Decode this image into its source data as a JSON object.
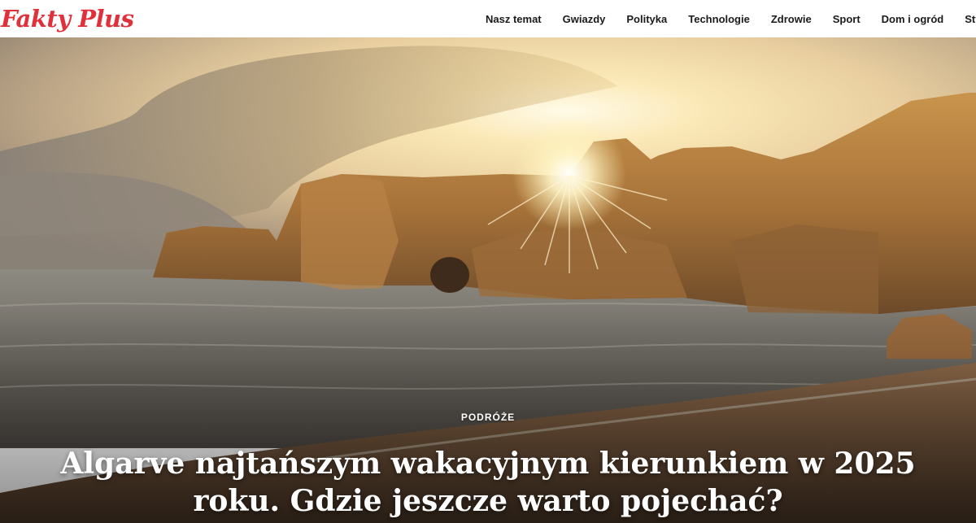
{
  "header": {
    "logo": "Fakty Plus",
    "nav": [
      "Nasz temat",
      "Gwiazdy",
      "Polityka",
      "Technologie",
      "Zdrowie",
      "Sport",
      "Dom i ogród",
      "Styl"
    ]
  },
  "hero": {
    "category": "PODRÓŻE",
    "headline": "Algarve najtańszym wakacyjnym kierunkiem w 2025 roku. Gdzie jeszcze warto pojechać?"
  },
  "colors": {
    "brand": "#e0313b",
    "nav_text": "#1a1a1a",
    "headline_text": "#ffffff"
  }
}
